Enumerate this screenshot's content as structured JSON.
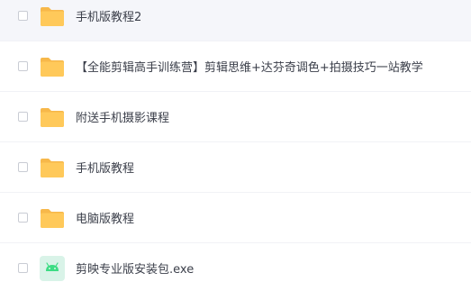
{
  "files": [
    {
      "name": "手机版教程2",
      "type": "folder",
      "icon": "folder-icon"
    },
    {
      "name": "【全能剪辑高手训练营】剪辑思维+达芬奇调色+拍摄技巧一站教学",
      "type": "folder",
      "icon": "folder-icon"
    },
    {
      "name": "附送手机摄影课程",
      "type": "folder",
      "icon": "folder-icon"
    },
    {
      "name": "手机版教程",
      "type": "folder",
      "icon": "folder-icon"
    },
    {
      "name": "电脑版教程",
      "type": "folder",
      "icon": "folder-icon"
    },
    {
      "name": "剪映专业版安装包.exe",
      "type": "apk",
      "icon": "android-app-icon"
    }
  ],
  "colors": {
    "folder": "#ffc95a",
    "folder_tab": "#f7b84a",
    "apk_bg": "#d9f3e8",
    "android": "#3ddc84"
  }
}
